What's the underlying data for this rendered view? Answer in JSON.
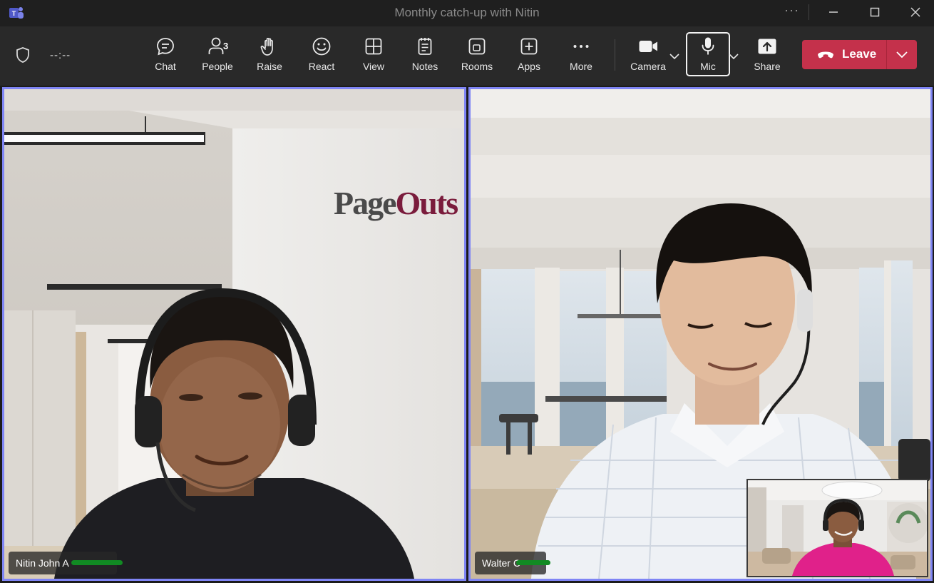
{
  "window": {
    "title": "Monthly catch-up with Nitin",
    "overflow_glyph": "···"
  },
  "meeting": {
    "timer": "--:--"
  },
  "toolbar": {
    "chat": "Chat",
    "people": "People",
    "people_count": "3",
    "raise": "Raise",
    "react": "React",
    "view": "View",
    "notes": "Notes",
    "rooms": "Rooms",
    "apps": "Apps",
    "more": "More",
    "camera": "Camera",
    "mic": "Mic",
    "share": "Share",
    "leave": "Leave"
  },
  "participants": [
    {
      "name": "Nitin John A"
    },
    {
      "name": "Walter C"
    }
  ],
  "background_sign": "PageOuts",
  "colors": {
    "leave_red": "#c4314b",
    "active_border": "#7f85f5",
    "redaction_green": "#118a23"
  },
  "icons": [
    "teams-logo-icon",
    "shield-icon",
    "chat-icon",
    "people-icon",
    "raise-hand-icon",
    "react-icon",
    "view-icon",
    "notes-icon",
    "rooms-icon",
    "apps-icon",
    "more-icon",
    "camera-icon",
    "mic-icon",
    "share-icon",
    "phone-hangup-icon",
    "chevron-down-icon",
    "minimize-icon",
    "maximize-icon",
    "close-icon"
  ]
}
